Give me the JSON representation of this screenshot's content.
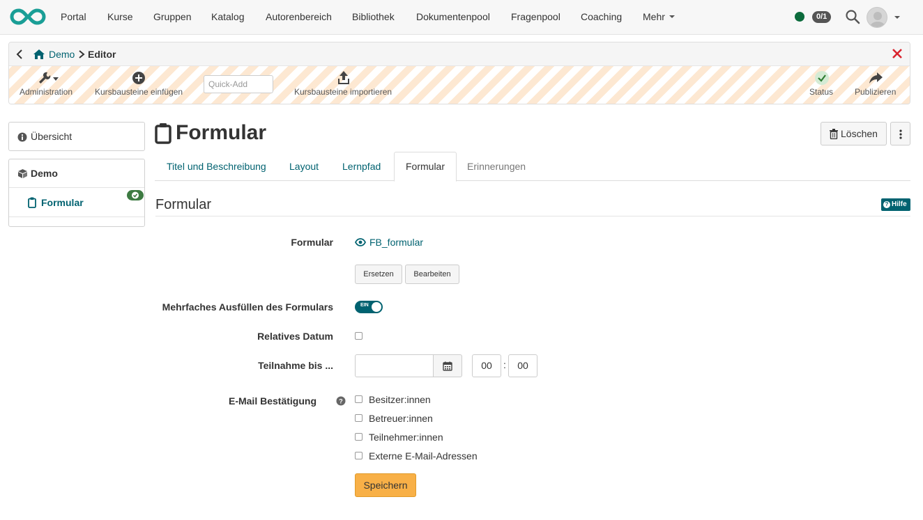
{
  "topnav": {
    "items": [
      {
        "label": "Portal"
      },
      {
        "label": "Kurse"
      },
      {
        "label": "Gruppen"
      },
      {
        "label": "Katalog"
      },
      {
        "label": "Autorenbereich"
      },
      {
        "label": "Bibliothek"
      },
      {
        "label": "Dokumentenpool"
      },
      {
        "label": "Fragenpool"
      },
      {
        "label": "Coaching"
      },
      {
        "label": "Mehr"
      }
    ],
    "counter": "0/1",
    "icons": {
      "logo": "openolat-infinity-logo",
      "status": "online-status-dot",
      "search": "search-icon",
      "avatar": "user-avatar"
    }
  },
  "editor": {
    "breadcrumb": {
      "home": "Demo",
      "current": "Editor"
    },
    "tools": {
      "administration": "Administration",
      "insert": "Kursbausteine einfügen",
      "quick_add_placeholder": "Quick-Add",
      "import": "Kursbausteine importieren",
      "status": "Status",
      "publish": "Publizieren"
    }
  },
  "sidebar": {
    "overview": "Übersicht",
    "tree_root": "Demo",
    "tree_child": "Formular"
  },
  "main": {
    "title": "Formular",
    "delete_label": "Löschen",
    "tabs": [
      {
        "label": "Titel und Beschreibung"
      },
      {
        "label": "Layout"
      },
      {
        "label": "Lernpfad"
      },
      {
        "label": "Formular",
        "active": true
      },
      {
        "label": "Erinnerungen"
      }
    ],
    "section_title": "Formular",
    "help_label": "Hilfe"
  },
  "form": {
    "form_label": "Formular",
    "form_file": "FB_formular",
    "replace_label": "Ersetzen",
    "edit_label": "Bearbeiten",
    "multiple_label": "Mehrfaches Ausfüllen des Formulars",
    "multiple_toggle_text": "EIN",
    "multiple_toggle_on": true,
    "relative_date_label": "Relatives Datum",
    "relative_date_checked": false,
    "participation_label": "Teilnahme bis ...",
    "participation_date": "",
    "participation_hour": "00",
    "participation_minute": "00",
    "email_label": "E-Mail Bestätigung",
    "email_options": [
      {
        "label": "Besitzer:innen",
        "checked": false
      },
      {
        "label": "Betreuer:innen",
        "checked": false
      },
      {
        "label": "Teilnehmer:innen",
        "checked": false
      },
      {
        "label": "Externe E-Mail-Adressen",
        "checked": false
      }
    ],
    "save_label": "Speichern"
  },
  "colors": {
    "accent": "#006270",
    "status_green": "#0c6b3c",
    "save": "#f8b047",
    "close_red": "#d9232d"
  }
}
